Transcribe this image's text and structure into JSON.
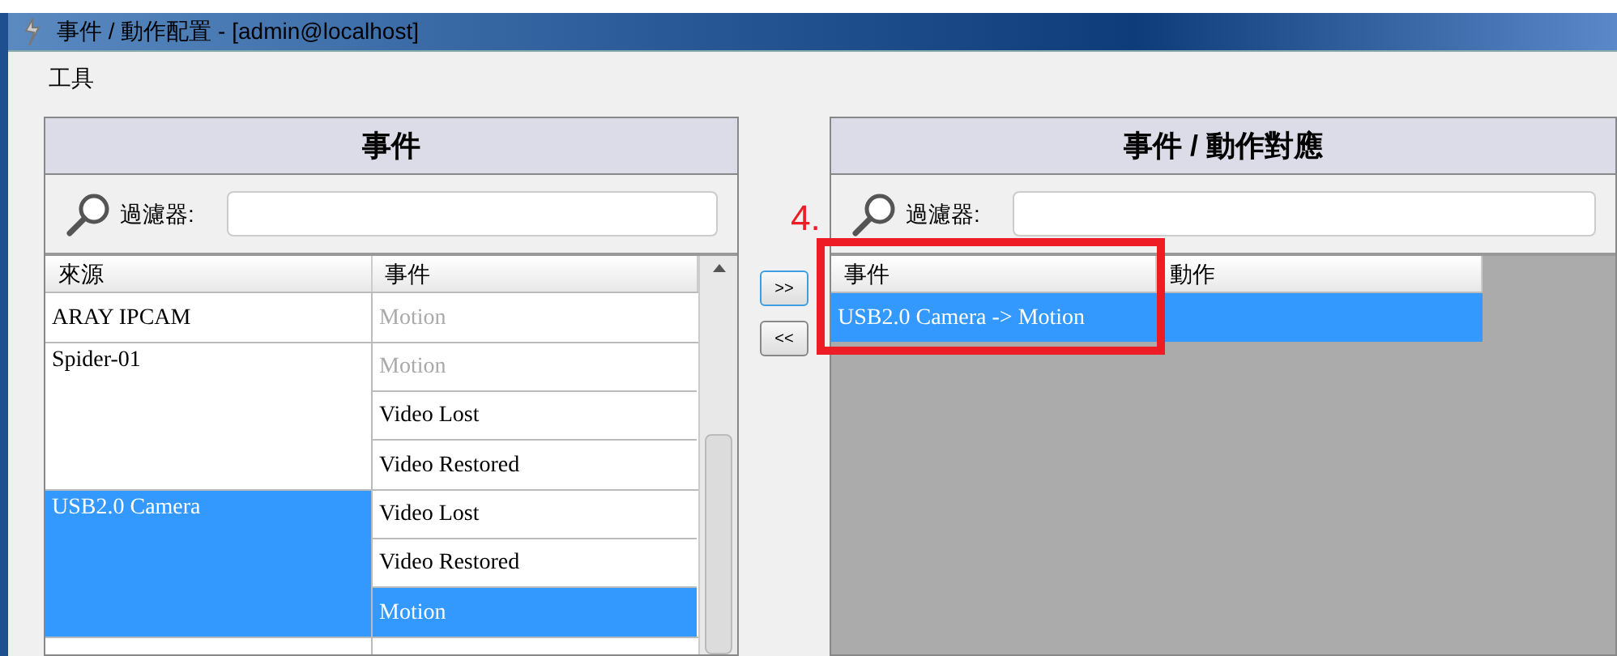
{
  "window": {
    "title": "事件 / 動作配置 - [admin@localhost]"
  },
  "menu": [
    "工具"
  ],
  "events_panel": {
    "title": "事件",
    "filter_label": "過濾器:",
    "columns": [
      "來源",
      "事件"
    ],
    "sources": [
      {
        "name": "ARAY IPCAM",
        "selected": false,
        "events": [
          {
            "name": "Motion",
            "disabled": true,
            "selected": false
          }
        ]
      },
      {
        "name": "Spider-01",
        "selected": false,
        "events": [
          {
            "name": "Motion",
            "disabled": true,
            "selected": false
          },
          {
            "name": "Video Lost",
            "disabled": false,
            "selected": false
          },
          {
            "name": "Video Restored",
            "disabled": false,
            "selected": false
          }
        ]
      },
      {
        "name": "USB2.0 Camera",
        "selected": true,
        "events": [
          {
            "name": "Video Lost",
            "disabled": false,
            "selected": false
          },
          {
            "name": "Video Restored",
            "disabled": false,
            "selected": false
          },
          {
            "name": "Motion",
            "disabled": false,
            "selected": true
          }
        ]
      }
    ]
  },
  "transfer_buttons": [
    ">>",
    "<<"
  ],
  "mapping_panel": {
    "title": "事件 / 動作對應",
    "filter_label": "過濾器:",
    "columns": [
      "事件",
      "動作"
    ],
    "rows": [
      {
        "event": "USB2.0 Camera -> Motion",
        "selected": true
      }
    ]
  },
  "annotation": {
    "label": "4."
  }
}
